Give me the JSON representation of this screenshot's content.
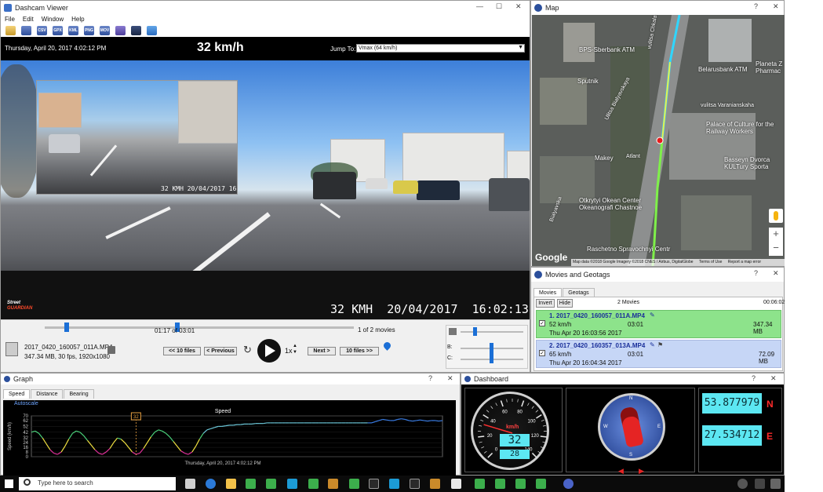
{
  "dashcam": {
    "title": "Dashcam Viewer",
    "menu": [
      "File",
      "Edit",
      "Window",
      "Help"
    ],
    "toolbar_icons": [
      {
        "name": "open-folder-icon",
        "label": ""
      },
      {
        "name": "save-icon",
        "label": ""
      },
      {
        "name": "export-csv-icon",
        "label": "CSV"
      },
      {
        "name": "export-gpx-icon",
        "label": "GPX"
      },
      {
        "name": "export-kml-icon",
        "label": "KML"
      },
      {
        "name": "export-png-icon",
        "label": "PNG"
      },
      {
        "name": "export-mov-icon",
        "label": "MOV"
      },
      {
        "name": "info-icon",
        "label": ""
      },
      {
        "name": "terminal-icon",
        "label": ""
      },
      {
        "name": "photo-icon",
        "label": ""
      },
      {
        "name": "fullscreen-icon",
        "label": ""
      },
      {
        "name": "settings-gear-icon",
        "label": ""
      }
    ],
    "date_text": "Thursday, April 20, 2017 4:02:12 PM",
    "speed_text": "32 km/h",
    "jump_label": "Jump To:",
    "jump_value": "Vmax (64 km/h)",
    "overlay_pip_text": "32 KMH 20/04/2017 16",
    "overlay_main_text": "32 KMH  20/04/2017  16:02:13",
    "logo_text_1": "Street",
    "logo_text_2": "GUARDIAN",
    "progress_fraction": 0.43,
    "time_text": "01:17 of 03:01",
    "movies_count": "1 of 2 movies",
    "file_name": "2017_0420_160057_011A.MP4",
    "file_info": "347.34 MB, 30 fps, 1920x1080",
    "btn_prev10": "<< 10 files",
    "btn_prev": "< Previous",
    "btn_next": "Next >",
    "btn_next10": "10 files >>",
    "rate": "1x",
    "b_label": "B:",
    "c_label": "C:"
  },
  "map": {
    "title": "Map",
    "labels": [
      "BPS-Sberbank ATM",
      "Belarusbank ATM",
      "Planeta Z Pharmac",
      "Sputnik",
      "Ulitsa Bialyavskaya",
      "vulitsa Varanianskaha",
      "Palace of Culture for the Railway Workers",
      "Makey",
      "Atlant",
      "Basseyn Dvorca KULTury Sporta",
      "Otkrytyi Okean Center Okeanografi Chastnoe",
      "Raschetno Spravochnyi Centr",
      "vulitsa Chkalava",
      "Bialyavska"
    ],
    "attribution": "Map data ©2018 Google Imagery ©2018 CNES / Airbus, DigitalGlobe",
    "terms": "Terms of Use",
    "report": "Report a map error",
    "google": "Google"
  },
  "movies": {
    "title": "Movies and Geotags",
    "tabs": [
      "Movies",
      "Geotags"
    ],
    "invert": "Invert",
    "hide": "Hide",
    "count": "2 Movies",
    "duration": "00:06:02",
    "items": [
      {
        "name": "1. 2017_0420_160057_011A.MP4",
        "speed": "52 km/h",
        "length": "03:01",
        "size": "347.34 MB",
        "date": "Thu Apr 20 16:03:56 2017"
      },
      {
        "name": "2. 2017_0420_160357_013A.MP4",
        "speed": "65 km/h",
        "length": "03:01",
        "size": "72.09 MB",
        "date": "Thu Apr 20 16:04:34 2017"
      }
    ]
  },
  "graph": {
    "title": "Graph",
    "tabs": [
      "Speed",
      "Distance",
      "Bearing"
    ],
    "autoscale": "Autoscale",
    "chart_title": "Speed",
    "ylabel": "Speed (km/h)",
    "xlabel": "Thursday, April 20, 2017 4:02:12 PM",
    "marker_label": "32"
  },
  "chart_data": {
    "type": "line",
    "title": "Speed",
    "ylabel": "Speed (km/h)",
    "xlabel": "Thursday, April 20, 2017 4:02:12 PM",
    "ylim": [
      0,
      70
    ],
    "yticks": [
      0,
      8,
      16,
      24,
      32,
      42,
      52,
      62,
      70
    ],
    "x": [
      0,
      4,
      8,
      12,
      16,
      20,
      24,
      28,
      32,
      36,
      40,
      44,
      48,
      52,
      56,
      60,
      64,
      68,
      72,
      76,
      80,
      84,
      88,
      92,
      96,
      100,
      104,
      108,
      112,
      116,
      120,
      124,
      128,
      132,
      136,
      140,
      144,
      148,
      152,
      156,
      160,
      164,
      168,
      172,
      176,
      180,
      184,
      188,
      192,
      196,
      200,
      204,
      208,
      212,
      216,
      220,
      224,
      228,
      232,
      236,
      240,
      244,
      248,
      252,
      256,
      260,
      264,
      268,
      272,
      276,
      280,
      284,
      288,
      292,
      296,
      300,
      304,
      308,
      312,
      316,
      320,
      324,
      328,
      332,
      336,
      340,
      344,
      348,
      352,
      356,
      360
    ],
    "values": [
      42,
      44,
      40,
      32,
      22,
      12,
      6,
      4,
      8,
      18,
      30,
      40,
      44,
      42,
      36,
      28,
      20,
      12,
      6,
      4,
      8,
      14,
      24,
      32,
      30,
      24,
      16,
      8,
      4,
      6,
      14,
      24,
      34,
      42,
      46,
      44,
      40,
      34,
      26,
      18,
      10,
      6,
      4,
      8,
      18,
      30,
      40,
      46,
      48,
      50,
      52,
      52,
      53,
      54,
      54,
      55,
      55,
      56,
      56,
      56,
      57,
      57,
      57,
      58,
      58,
      58,
      58,
      58,
      58,
      58,
      58,
      58,
      58,
      58,
      58,
      58,
      58,
      58,
      58,
      58,
      58,
      58,
      58,
      58,
      58,
      58,
      58,
      58,
      58,
      58,
      58
    ],
    "tail_x": [
      364,
      368,
      372,
      376,
      380,
      384,
      388,
      392,
      396,
      400,
      404,
      408,
      412,
      416,
      420,
      424,
      428,
      432,
      436,
      440
    ],
    "tail_values": [
      58,
      60,
      62,
      64,
      63,
      62,
      62,
      64,
      65,
      64,
      62,
      61,
      62,
      63,
      62,
      61,
      62,
      62,
      61,
      62
    ],
    "marker_x": 112
  },
  "dashboard": {
    "title": "Dashboard",
    "unit": "km/h",
    "speed": "32",
    "odo": "28",
    "gauge_ticks": [
      "0",
      "20",
      "40",
      "60",
      "80",
      "100",
      "120",
      "140"
    ],
    "lat": "53.877979",
    "lat_dir": "N",
    "lon": "27.534712",
    "lon_dir": "E",
    "compass_n": "N",
    "compass_s": "S",
    "compass_e": "E",
    "compass_w": "W"
  },
  "taskbar": {
    "search_placeholder": "Type here to search"
  }
}
